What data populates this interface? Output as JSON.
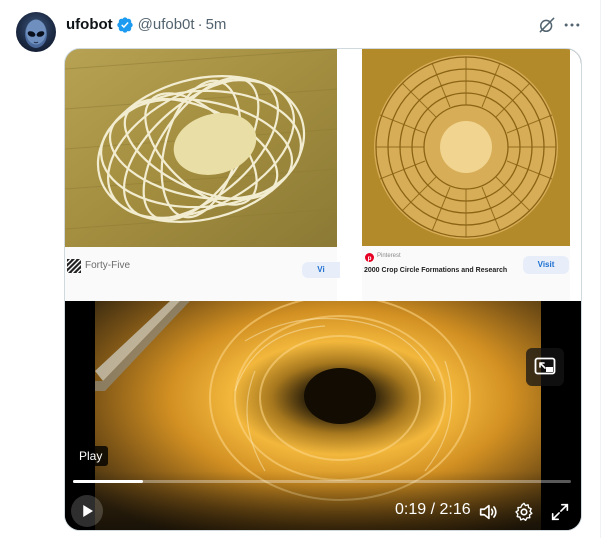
{
  "author": {
    "display_name": "ufobot",
    "handle": "@ufob0t",
    "separator": "·",
    "timestamp": "5m",
    "verified": true
  },
  "icons": {
    "verified": "verified-badge-icon",
    "grok": "grok-icon",
    "more": "more-icon",
    "pip": "pip-icon",
    "play": "play-icon",
    "volume": "volume-icon",
    "settings": "gear-icon",
    "fullscreen": "fullscreen-icon"
  },
  "colors": {
    "verified": "#1d9bf0",
    "secondary_text": "#536471",
    "card_border": "#cfd9de"
  },
  "media": {
    "left_caption": {
      "brand": "Forty-Five",
      "visit": "Vi"
    },
    "right_caption": {
      "source": "Pinterest",
      "title": "2000 Crop Circle Formations and Research",
      "visit": "Visit"
    }
  },
  "video": {
    "tooltip": "Play",
    "current_time": "0:19",
    "time_separator": "/",
    "duration": "2:16",
    "progress_fraction": 0.14
  }
}
